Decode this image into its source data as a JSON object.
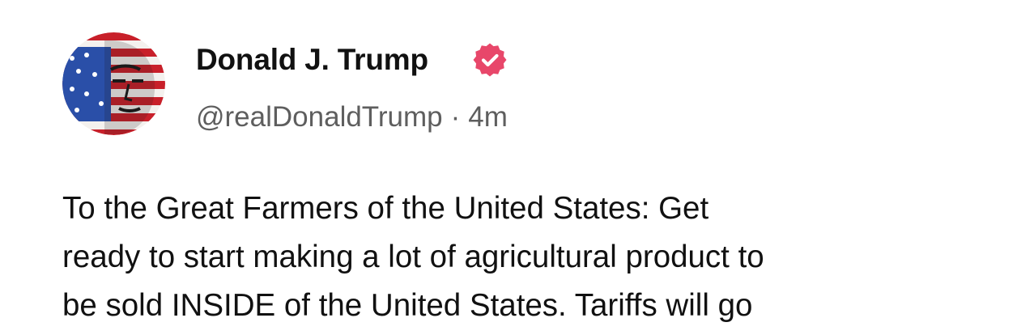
{
  "post": {
    "author": {
      "display_name": "Donald J. Trump",
      "handle": "@realDonaldTrump",
      "verified": true,
      "verified_color": "#e8476a",
      "avatar_icon": "flag-portrait-avatar"
    },
    "meta": {
      "separator": "·",
      "timestamp": "4m"
    },
    "body_lines": [
      "To the Great Farmers of the United States: Get",
      "ready to start making a lot of agricultural product to",
      "be sold INSIDE of the United States. Tariffs will go"
    ]
  }
}
